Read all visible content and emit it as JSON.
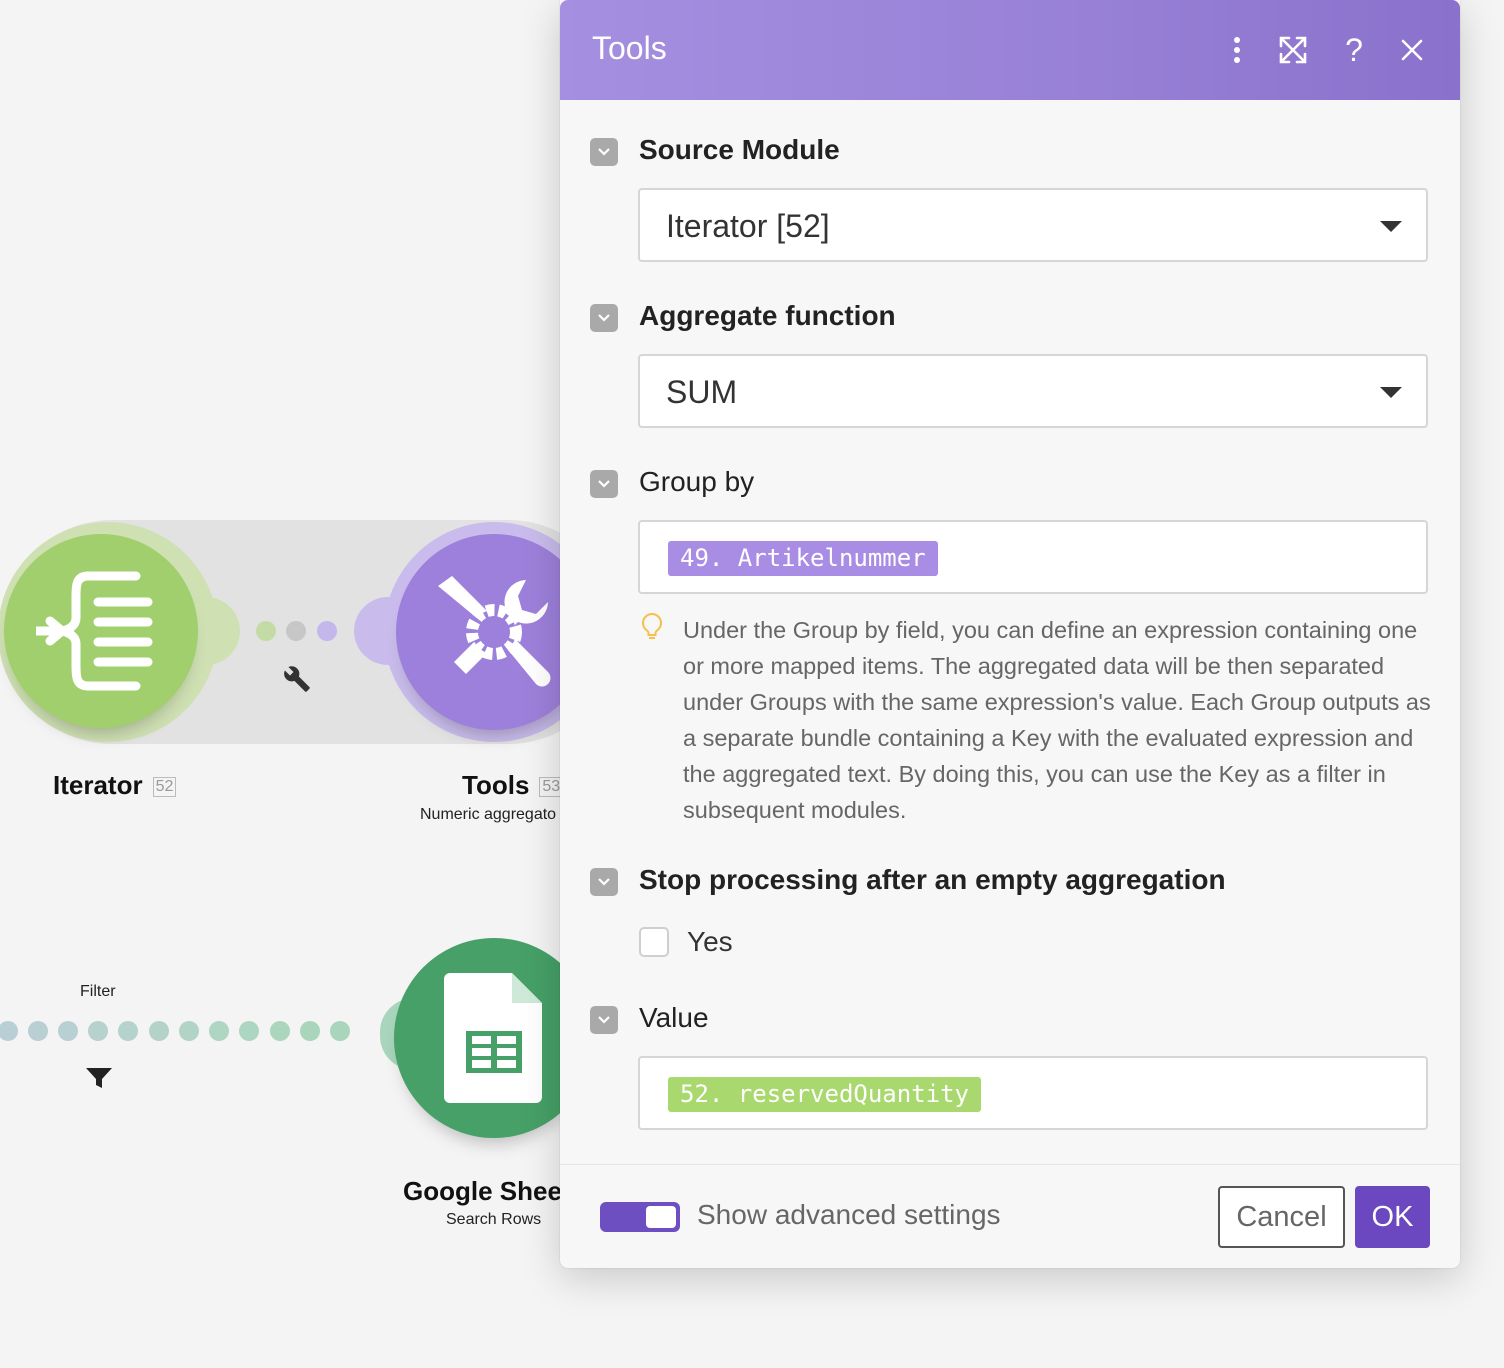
{
  "canvas": {
    "iterator_node": {
      "label": "Iterator",
      "id": "52"
    },
    "tools_node": {
      "label": "Tools",
      "id": "53",
      "subtitle": "Numeric aggregato"
    },
    "filter_label": "Filter",
    "gsheets_node": {
      "label": "Google Shee",
      "subtitle": "Search Rows"
    }
  },
  "dialog": {
    "title": "Tools",
    "fields": {
      "source_module": {
        "label": "Source Module",
        "value": "Iterator [52]"
      },
      "aggregate_function": {
        "label": "Aggregate function",
        "value": "SUM"
      },
      "group_by": {
        "label": "Group by",
        "value": "49. Artikelnummer",
        "hint": "Under the Group by field, you can define an expression containing one or more mapped items. The aggregated data will be then separated under Groups with the same expression's value. Each Group outputs as a separate bundle containing a Key with the evaluated expression and the aggregated text. By doing this, you can use the Key as a filter in subsequent modules."
      },
      "stop_processing": {
        "label": "Stop processing after an empty aggregation",
        "checkbox_label": "Yes",
        "checked": false
      },
      "value": {
        "label": "Value",
        "value": "52. reservedQuantity"
      }
    },
    "footer": {
      "advanced_label": "Show advanced settings",
      "advanced_on": true,
      "cancel_label": "Cancel",
      "ok_label": "OK"
    }
  },
  "colors": {
    "header_purple": "#9a83d8",
    "ok_purple": "#6c48c0",
    "iterator_green": "#a2cf6e",
    "tools_purple": "#9d80db",
    "sheets_green": "#46a067"
  }
}
